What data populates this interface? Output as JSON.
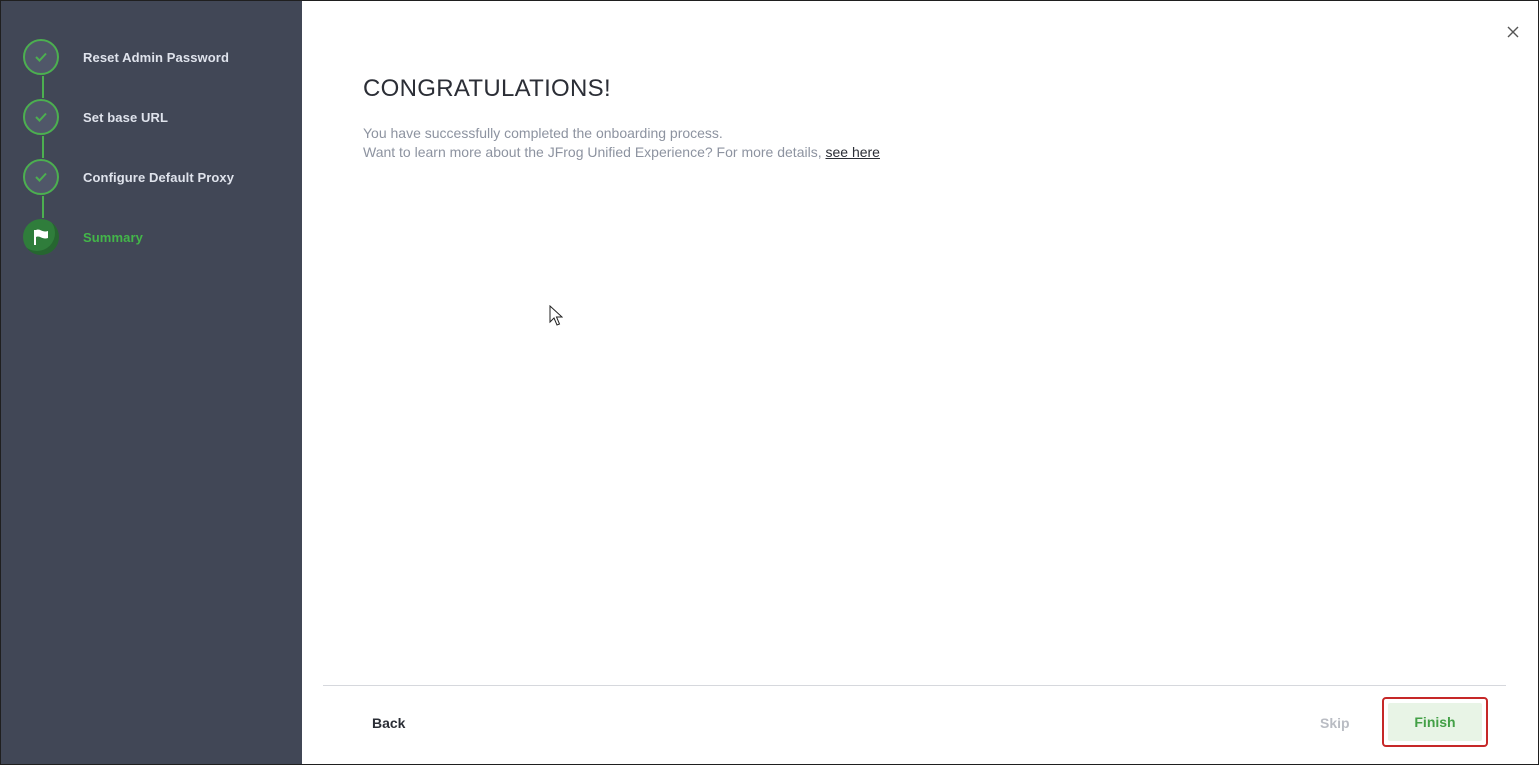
{
  "wizard": {
    "steps": [
      {
        "label": "Reset Admin Password",
        "state": "done",
        "icon": "check-icon"
      },
      {
        "label": "Set base URL",
        "state": "done",
        "icon": "check-icon"
      },
      {
        "label": "Configure Default Proxy",
        "state": "done",
        "icon": "check-icon"
      },
      {
        "label": "Summary",
        "state": "current",
        "icon": "flag-icon"
      }
    ]
  },
  "main": {
    "heading": "CONGRATULATIONS!",
    "line1": "You have successfully completed the onboarding process.",
    "line2_prefix": "Want to learn more about the JFrog Unified Experience? For more details, ",
    "link_text": "see here"
  },
  "footer": {
    "back_label": "Back",
    "skip_label": "Skip",
    "finish_label": "Finish"
  },
  "colors": {
    "sidebar_bg": "#414756",
    "accent_green": "#43b649",
    "finish_border": "#c62828"
  }
}
